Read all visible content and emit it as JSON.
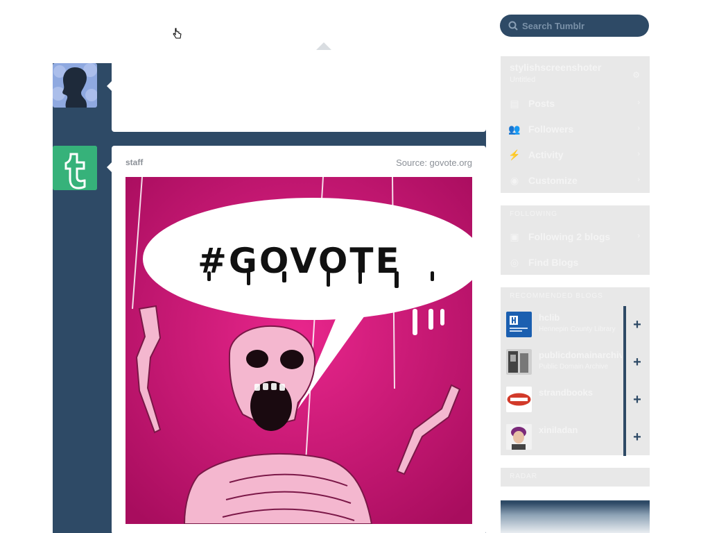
{
  "search": {
    "placeholder": "Search Tumblr"
  },
  "compose": {
    "avatar": "silhouette-avatar"
  },
  "post": {
    "author": "staff",
    "source": "Source: govote.org",
    "poster_text": "#GOVOTE"
  },
  "account": {
    "blog_name": "stylishscreenshoter",
    "blog_subtitle": "Untitled",
    "items": [
      {
        "label": "Posts",
        "icon": "document-icon"
      },
      {
        "label": "Followers",
        "icon": "people-icon"
      },
      {
        "label": "Activity",
        "icon": "lightning-icon"
      },
      {
        "label": "Customize",
        "icon": "eye-icon"
      }
    ]
  },
  "following": {
    "header": "Following",
    "items": [
      {
        "label": "Following 2 blogs",
        "icon": "person-card-icon"
      },
      {
        "label": "Find Blogs",
        "icon": "compass-icon"
      }
    ]
  },
  "recommended": {
    "header": "Recommended Blogs",
    "blogs": [
      {
        "name": "hclib",
        "subtitle": "Hennepin County Library",
        "follow": "+"
      },
      {
        "name": "publicdomainarchive",
        "subtitle": "Public Domain Archive",
        "follow": "+"
      },
      {
        "name": "strandbooks",
        "subtitle": "",
        "follow": "+"
      },
      {
        "name": "xiniladan",
        "subtitle": "",
        "follow": "+"
      }
    ]
  },
  "radar": {
    "header": "Radar"
  },
  "colors": {
    "navy": "#2e4a66",
    "staff_green": "#36b27a",
    "poster_magenta": "#d41a7a",
    "panel_gray": "#e8e8e8"
  }
}
